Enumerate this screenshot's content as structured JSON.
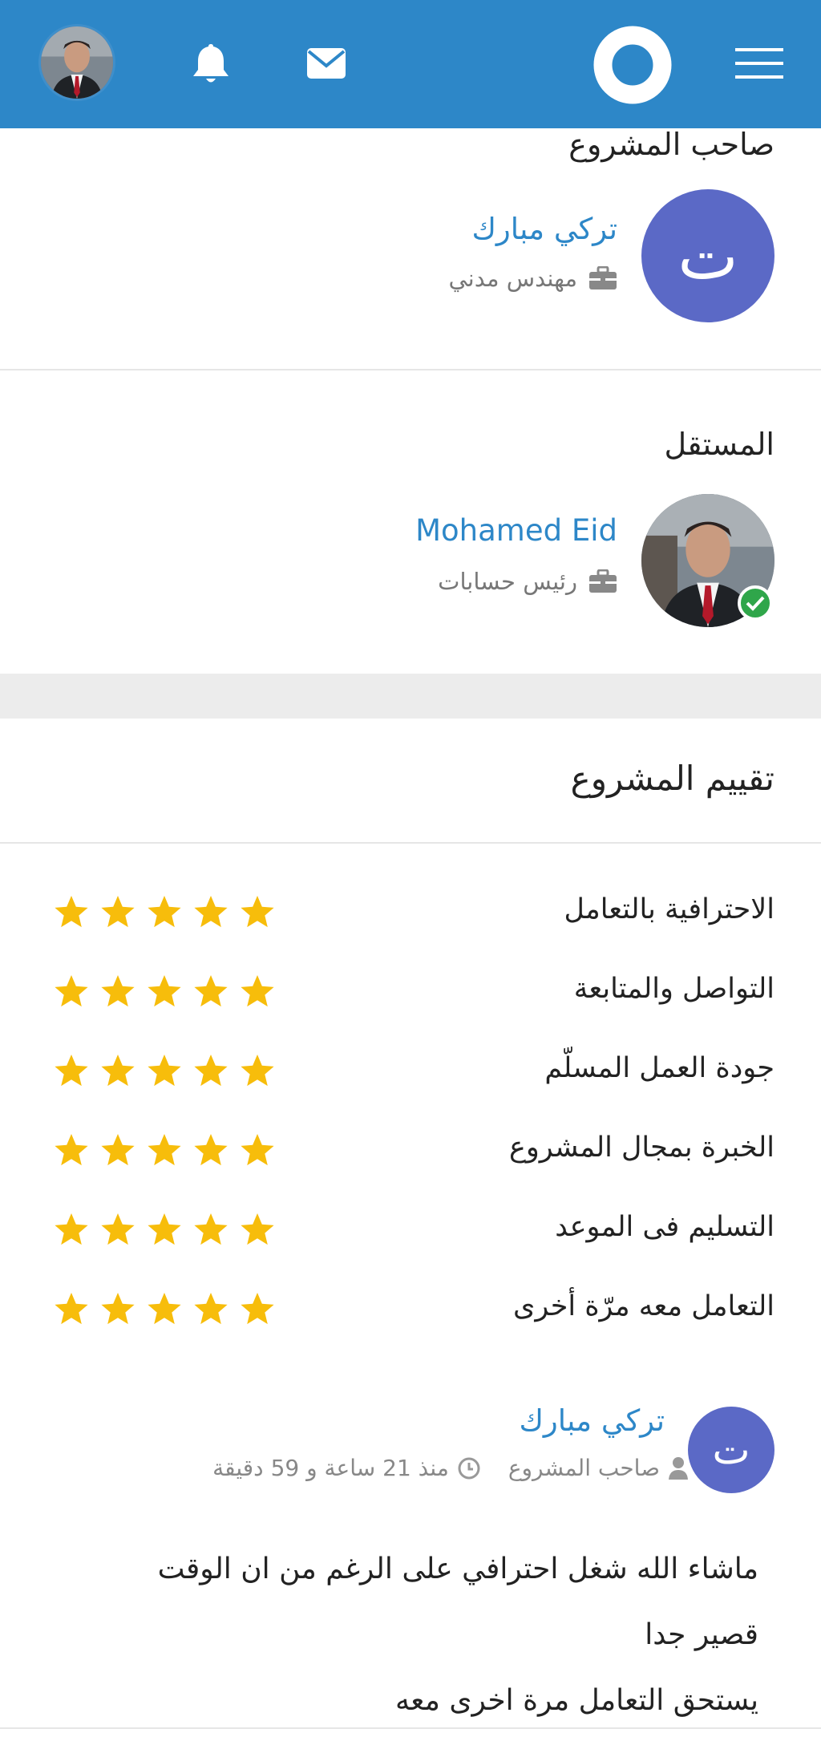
{
  "header": {
    "icons": [
      "avatar",
      "bell-icon",
      "envelope-icon",
      "logo-ring",
      "hamburger-icon"
    ],
    "bar_color": "#2d87c8"
  },
  "owner_section": {
    "title": "صاحب المشروع",
    "avatar_letter": "ت",
    "name": "تركي مبارك",
    "job": "مهندس مدني"
  },
  "freelancer_section": {
    "title": "المستقل",
    "name": "Mohamed Eid",
    "job": "رئيس حسابات"
  },
  "rating_section": {
    "title": "تقييم المشروع",
    "star_color": "#f7bd0b",
    "criteria": [
      {
        "label": "الاحترافية بالتعامل",
        "stars": 5
      },
      {
        "label": "التواصل والمتابعة",
        "stars": 5
      },
      {
        "label": "جودة العمل المسلّم",
        "stars": 5
      },
      {
        "label": "الخبرة بمجال المشروع",
        "stars": 5
      },
      {
        "label": "التسليم فى الموعد",
        "stars": 5
      },
      {
        "label": "التعامل معه مرّة أخرى",
        "stars": 5
      }
    ]
  },
  "review": {
    "avatar_letter": "ت",
    "name": "تركي مبارك",
    "role": "صاحب المشروع",
    "time": "منذ 21 ساعة و 59 دقيقة",
    "lines": [
      "ماشاء الله شغل احترافي على الرغم من ان الوقت",
      "قصير جدا",
      "يستحق التعامل مرة اخرى معه"
    ]
  }
}
